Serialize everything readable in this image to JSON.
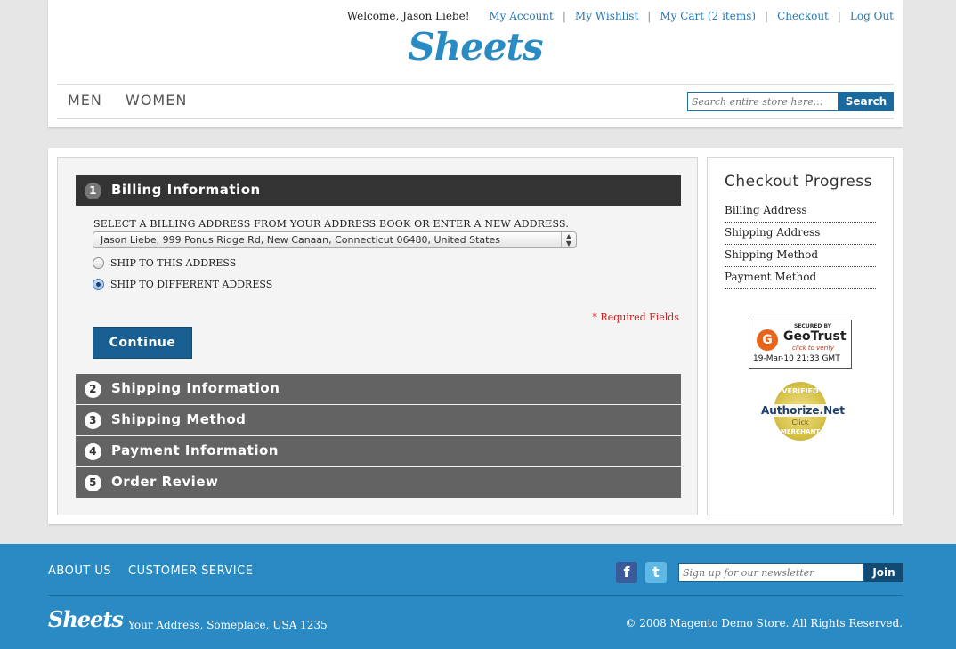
{
  "header": {
    "welcome": "Welcome, Jason Liebe!",
    "links": {
      "account": "My Account",
      "wishlist": "My Wishlist",
      "cart": "My Cart (2 items)",
      "checkout": "Checkout",
      "logout": "Log Out"
    },
    "logo": "Sheets",
    "nav": {
      "men": "MEN",
      "women": "WOMEN"
    },
    "search": {
      "placeholder": "Search entire store here...",
      "button": "Search"
    }
  },
  "checkout": {
    "steps": [
      {
        "num": "1",
        "title": "Billing Information"
      },
      {
        "num": "2",
        "title": "Shipping Information"
      },
      {
        "num": "3",
        "title": "Shipping Method"
      },
      {
        "num": "4",
        "title": "Payment Information"
      },
      {
        "num": "5",
        "title": "Order Review"
      }
    ],
    "billing": {
      "select_label": "SELECT A BILLING ADDRESS FROM YOUR ADDRESS BOOK OR ENTER A NEW ADDRESS.",
      "selected_address": "Jason Liebe, 999 Ponus Ridge Rd, New Canaan, Connecticut 06480, United States",
      "ship_this": "SHIP TO THIS ADDRESS",
      "ship_different": "SHIP TO DIFFERENT ADDRESS",
      "ship_different_checked": true,
      "required": "* Required Fields",
      "continue": "Continue"
    }
  },
  "sidebar": {
    "title": "Checkout Progress",
    "items": [
      "Billing Address",
      "Shipping Address",
      "Shipping Method",
      "Payment Method"
    ],
    "geotrust": {
      "secured": "SECURED BY",
      "name": "GeoTrust",
      "verify": "click to verify",
      "date": "19-Mar-10 21:33 GMT"
    },
    "authorize": {
      "verified": "VERIFIED",
      "name": "Authorize.Net",
      "click": "Click",
      "merchant": "MERCHANT"
    }
  },
  "footer": {
    "about": "ABOUT US",
    "service": "CUSTOMER SERVICE",
    "newsletter_placeholder": "Sign up for our newsletter",
    "join": "Join",
    "logo": "Sheets",
    "address": "Your Address, Someplace, USA 1235",
    "copyright": "© 2008 Magento Demo Store. All Rights Reserved."
  },
  "colors": {
    "brand_blue": "#2a8ac4",
    "button_blue": "#1a5f92",
    "active_step": "#333333",
    "inactive_step": "#636363",
    "required_red": "#d21b1b"
  }
}
